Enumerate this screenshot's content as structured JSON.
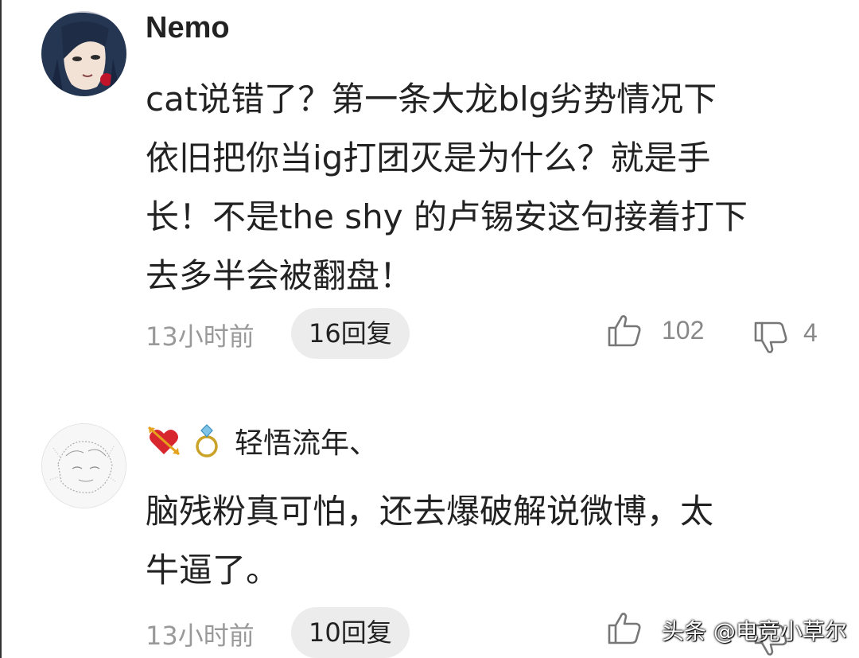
{
  "comments": [
    {
      "username": "Nemo",
      "avatar_icon": "anime-character-avatar",
      "text_lines": [
        "cat说错了？第一条大龙blg劣势情况下",
        "依旧把你当ig打团灭是为什么？就是手",
        "长！不是the shy 的卢锡安这句接着打下",
        "去多半会被翻盘！"
      ],
      "time": "13小时前",
      "reply_label": "16回复",
      "likes": "102",
      "dislikes": "4"
    },
    {
      "badges": [
        "heart-arrow-icon",
        "ring-icon"
      ],
      "username": "轻悟流年、",
      "avatar_icon": "sketch-avatar",
      "text_lines": [
        "脑残粉真可怕，还去爆破解说微博，太",
        "牛逼了。"
      ],
      "time": "13小时前",
      "reply_label": "10回复"
    }
  ],
  "watermark": "头条 @电竞小草尔",
  "colors": {
    "text": "#222222",
    "meta": "#999999",
    "pill_bg": "#ececec"
  }
}
